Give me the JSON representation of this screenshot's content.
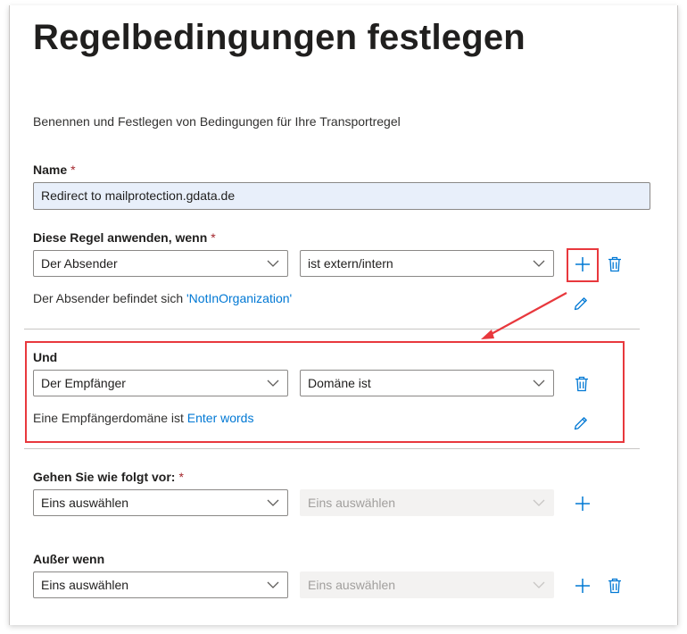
{
  "page": {
    "title": "Regelbedingungen festlegen",
    "description": "Benennen und Festlegen von Bedingungen für Ihre Transportregel"
  },
  "name_field": {
    "label": "Name",
    "required_mark": "*",
    "value": "Redirect to mailprotection.gdata.de"
  },
  "apply_rule": {
    "label": "Diese Regel anwenden, wenn",
    "required_mark": "*",
    "condition_select": "Der Absender",
    "value_select": "ist extern/intern",
    "info_text": "Der Absender befindet sich ",
    "info_link": "'NotInOrganization'"
  },
  "and_condition": {
    "label": "Und",
    "condition_select": "Der Empfänger",
    "value_select": "Domäne ist",
    "info_text": "Eine Empfängerdomäne ist ",
    "info_link": "Enter words"
  },
  "action": {
    "label": "Gehen Sie wie folgt vor:",
    "required_mark": "*",
    "condition_select": "Eins auswählen",
    "value_select": "Eins auswählen"
  },
  "exception": {
    "label": "Außer wenn",
    "condition_select": "Eins auswählen",
    "value_select": "Eins auswählen"
  },
  "icons": {
    "add": "plus-icon",
    "delete": "trash-icon",
    "edit": "pencil-icon",
    "dropdown": "chevron-down-icon"
  },
  "colors": {
    "accent": "#0078d4",
    "highlight": "#e8383d",
    "required": "#a4262c",
    "field_fill": "#e8effa"
  }
}
